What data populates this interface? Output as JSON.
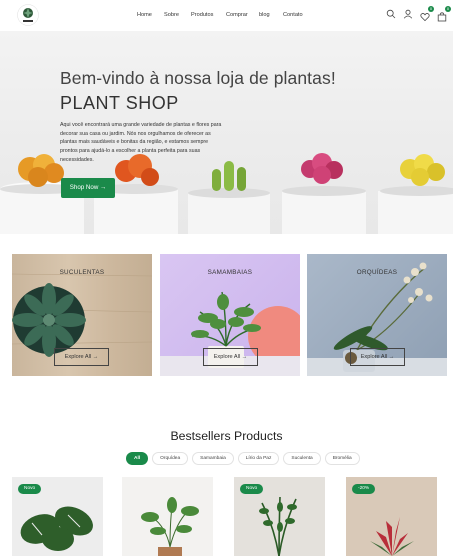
{
  "header": {
    "nav": [
      "Home",
      "Sobre",
      "Produtos",
      "Comprar",
      "blog",
      "Contato"
    ],
    "wishlist_count": "0",
    "cart_count": "0"
  },
  "hero": {
    "title": "Bem-vindo à nossa loja de plantas!",
    "brand": "PLANT SHOP",
    "text": "Aqui você encontrará uma grande variedade de plantas e flores para decorar sua casa ou jardim. Nós nos orgulhamos de oferecer as plantas mais saudáveis e bonitas da região, e estamos sempre prontos para ajudá-lo a escolher a planta perfeita para suas necessidades.",
    "button": "Shop Now →"
  },
  "categories": [
    {
      "label": "SUCULENTAS",
      "button": "Explore All →"
    },
    {
      "label": "SAMAMBAIAS",
      "button": "Explore All →"
    },
    {
      "label": "ORQUÍDEAS",
      "button": "Explore All →"
    }
  ],
  "bestsellers": {
    "title": "Bestsellers Products",
    "filters": [
      "All",
      "Orquídea",
      "Samambaia",
      "Lírio da Paz",
      "Suculenta",
      "Bromélia"
    ],
    "products": [
      {
        "badge": "Novo"
      },
      {
        "badge": ""
      },
      {
        "badge": "Novo"
      },
      {
        "badge": "-20%"
      }
    ]
  },
  "colors": {
    "accent": "#1a8a4a"
  }
}
